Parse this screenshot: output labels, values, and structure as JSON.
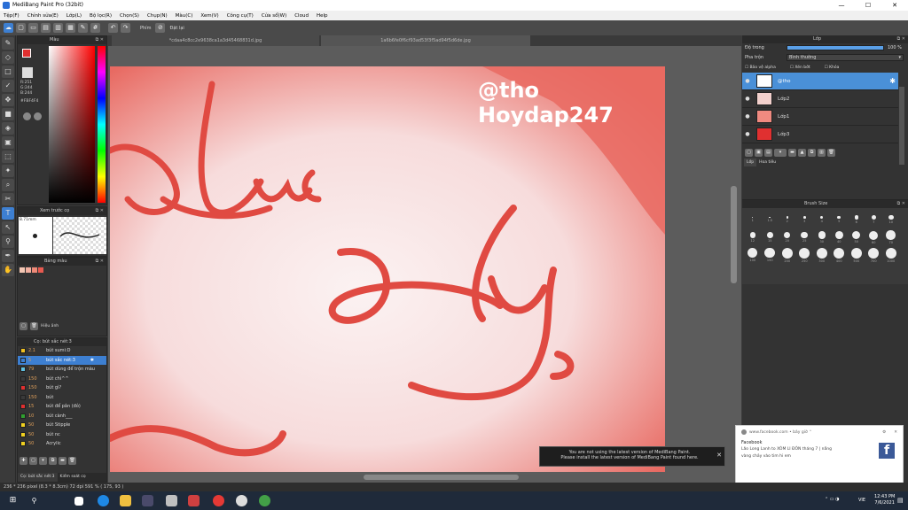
{
  "window": {
    "title": "MediBang Paint Pro (32bit)",
    "minimize": "—",
    "maximize": "☐",
    "close": "✕"
  },
  "menu": [
    "Tệp(F)",
    "Chỉnh sửa(E)",
    "Lớp(L)",
    "Bộ lọc(R)",
    "Chọn(S)",
    "Chụp(N)",
    "Màu(C)",
    "Xem(V)",
    "Công cụ(T)",
    "Cửa sổ(W)",
    "Cloud",
    "Help"
  ],
  "toolbar": {
    "phone_label": "Phím",
    "snap_label": "Đặt lại"
  },
  "tabs": {
    "active": "*cdaa4c8cc2e9638ca1a3d45468831d.jpg",
    "other": "1a6b6fe0f6cf93ad53f3f5ad94f5d6de.jpg"
  },
  "color_panel": {
    "title": "Màu",
    "r": "R:251",
    "g": "G:244",
    "b": "B:244",
    "hex": "#FBF4F4",
    "fg_color": "#e03030",
    "bg_color": "#ffffff"
  },
  "preview_panel": {
    "title": "Xem trước cọ",
    "size": "8.71mm"
  },
  "palette_panel": {
    "title": "Bảng màu",
    "swatches": [
      "#f4c7b4",
      "#f3b0a0",
      "#ee8a78",
      "#e85a50"
    ],
    "footer_label": "Hiệu ảnh"
  },
  "brush_panel": {
    "title": "Cọ: bút sắc nét:3",
    "items": [
      {
        "size": "2.1",
        "name": "bút sumi:D",
        "color": "#f0c020",
        "selected": false
      },
      {
        "size": "5",
        "name": "bút sắc nét:3",
        "color": "#3d7fd1",
        "selected": true
      },
      {
        "size": "79",
        "name": "bút dùng để trộn màu",
        "color": "#60c0e0",
        "selected": false
      },
      {
        "size": "150",
        "name": "bút chì^^",
        "color": "#3a3a3a",
        "selected": false
      },
      {
        "size": "150",
        "name": "bút gì?",
        "color": "#e03030",
        "selected": false
      },
      {
        "size": "150",
        "name": "bút",
        "color": "#3a3a3a",
        "selected": false
      },
      {
        "size": "15",
        "name": "bút để pân (đỏ)",
        "color": "#e03030",
        "selected": false
      },
      {
        "size": "10",
        "name": "bút cành___",
        "color": "#30a030",
        "selected": false
      },
      {
        "size": "50",
        "name": "bút Stipple",
        "color": "#f0d020",
        "selected": false
      },
      {
        "size": "50",
        "name": "bút nc",
        "color": "#f0d020",
        "selected": false
      },
      {
        "size": "50",
        "name": "Acrylic",
        "color": "#f0d020",
        "selected": false
      }
    ],
    "bottom_tabs": [
      "Cọ: bút sắc nét:3",
      "Kiểm soát cọ"
    ]
  },
  "canvas": {
    "watermark_line1": "@tho",
    "watermark_line2": "Hoydap247",
    "word1": "Luc",
    "word2": "Ly"
  },
  "layers_panel": {
    "title": "Lớp",
    "opacity_label": "Độ trong",
    "opacity_value": "100 %",
    "blend_label": "Pha trộn",
    "blend_value": "Bình thường",
    "protect_alpha": "Bảo vệ alpha",
    "clipping": "Xén bớt",
    "lock": "Khóa",
    "layers": [
      {
        "name": "@tho",
        "selected": true,
        "thumb": "#ffffff"
      },
      {
        "name": "Lớp2",
        "selected": false,
        "thumb": "#f2d0cc"
      },
      {
        "name": "Lớp1",
        "selected": false,
        "thumb": "#f08a80"
      },
      {
        "name": "Lớp3",
        "selected": false,
        "thumb": "#e03030"
      }
    ],
    "footer_tabs": [
      "Lớp",
      "Hoa tiêu"
    ]
  },
  "brush_size_panel": {
    "title": "Brush Size",
    "sizes": [
      "1",
      "1.5",
      "2",
      "3",
      "4",
      "5",
      "6",
      "7",
      "10",
      "12",
      "15",
      "20",
      "25",
      "30",
      "40",
      "50",
      "60",
      "70",
      "100",
      "150",
      "200",
      "250",
      "300",
      "400",
      "500",
      "700",
      "1000"
    ]
  },
  "statusbar": {
    "text": "236 * 236 pixel   (8.3 * 8.3cm)   72 dpi   591 %   ( 175, 93 )"
  },
  "notice": {
    "line1": "You are not using the latest version of MediBang Paint.",
    "line2": "Please install the latest version of MediBang Paint found here.",
    "close": "✕"
  },
  "toast": {
    "source": "www.facebook.com • bây giờ ⌃",
    "app": "Facebook",
    "line1": "Lão Long Lanh to XÓM LI ĐÔN tháng 7 | nắng",
    "line2": "vàng chảy vào tim hi em"
  },
  "taskbar": {
    "time": "12:43 PM",
    "date": "7/6/2021",
    "lang": "VIE"
  }
}
